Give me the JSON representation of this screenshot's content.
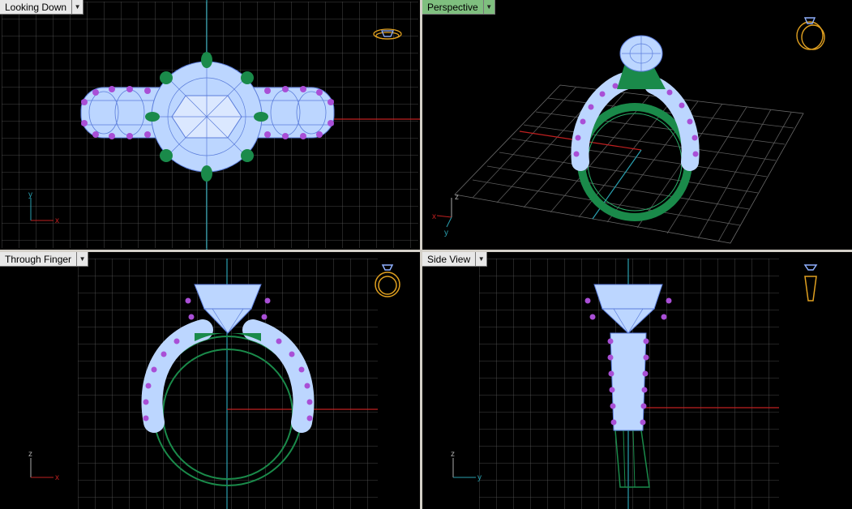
{
  "viewports": {
    "top_left": {
      "title": "Looking Down",
      "active": false
    },
    "top_right": {
      "title": "Perspective",
      "active": true
    },
    "bottom_left": {
      "title": "Through Finger",
      "active": false
    },
    "bottom_right": {
      "title": "Side View",
      "active": false
    }
  },
  "axis_labels": {
    "x": "x",
    "y": "y",
    "z": "z"
  },
  "colors": {
    "background": "#000000",
    "grid": "#5a5a5a",
    "stone": "#bcd6ff",
    "stone_line": "#5b7ddb",
    "prong_green": "#1a8a4a",
    "accent_purple": "#a94fd6",
    "gold_icon": "#e0a020",
    "axis_red": "#c02020",
    "axis_cyan": "#2aa0b0",
    "active_tab": "#7fbf7f"
  },
  "icons": {
    "view_cube": "ring-preview-icon",
    "dropdown": "chevron-down-icon"
  }
}
